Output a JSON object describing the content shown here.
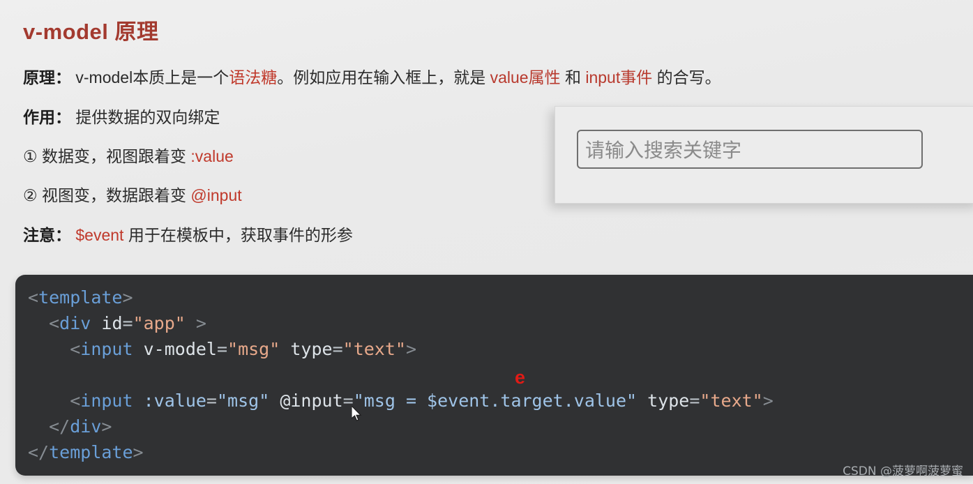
{
  "slide": {
    "title": "v-model 原理",
    "background_color": "#ececec",
    "title_color": "#a33a2f"
  },
  "body_lines": {
    "principle": {
      "label": "原理：",
      "part1": " v-model本质上是一个",
      "highlight1": "语法糖",
      "part2": "。例如应用在输入框上，就是 ",
      "highlight2": "value属性",
      "part3": " 和 ",
      "highlight3": "input事件",
      "part4": " 的合写。"
    },
    "role": {
      "label": "作用：",
      "text": " 提供数据的双向绑定"
    },
    "point1": {
      "marker": "①",
      "text": " 数据变，视图跟着变 ",
      "highlight": ":value"
    },
    "point2": {
      "marker": "②",
      "text": " 视图变，数据跟着变 ",
      "highlight": "@input"
    },
    "note": {
      "label": "注意：",
      "highlight": " $event",
      "text": " 用于在模板中，获取事件的形参"
    }
  },
  "demo_panel": {
    "input_placeholder": "请输入搜索关键字"
  },
  "code": {
    "lines": [
      {
        "id": "line-template-open",
        "tokens": [
          {
            "t": "punct",
            "v": "<"
          },
          {
            "t": "tag",
            "v": "template"
          },
          {
            "t": "punct",
            "v": ">"
          }
        ]
      },
      {
        "id": "line-div-open",
        "tokens": [
          {
            "t": "plain",
            "v": "  "
          },
          {
            "t": "punct",
            "v": "<"
          },
          {
            "t": "tag",
            "v": "div"
          },
          {
            "t": "plain",
            "v": " "
          },
          {
            "t": "attr",
            "v": "id"
          },
          {
            "t": "eq",
            "v": "="
          },
          {
            "t": "str",
            "v": "\"app\""
          },
          {
            "t": "plain",
            "v": " "
          },
          {
            "t": "punct",
            "v": ">"
          }
        ]
      },
      {
        "id": "line-input-vmodel",
        "tokens": [
          {
            "t": "plain",
            "v": "    "
          },
          {
            "t": "punct",
            "v": "<"
          },
          {
            "t": "tag",
            "v": "input"
          },
          {
            "t": "plain",
            "v": " "
          },
          {
            "t": "attr",
            "v": "v-model"
          },
          {
            "t": "eq",
            "v": "="
          },
          {
            "t": "str",
            "v": "\"msg\""
          },
          {
            "t": "plain",
            "v": " "
          },
          {
            "t": "attr",
            "v": "type"
          },
          {
            "t": "eq",
            "v": "="
          },
          {
            "t": "str",
            "v": "\"text\""
          },
          {
            "t": "punct",
            "v": ">"
          }
        ]
      },
      {
        "id": "line-blank",
        "tokens": [
          {
            "t": "plain",
            "v": " "
          }
        ]
      },
      {
        "id": "line-input-value-input",
        "tokens": [
          {
            "t": "plain",
            "v": "    "
          },
          {
            "t": "punct",
            "v": "<"
          },
          {
            "t": "tag",
            "v": "input"
          },
          {
            "t": "plain",
            "v": " "
          },
          {
            "t": "val",
            "v": ":value"
          },
          {
            "t": "eq",
            "v": "="
          },
          {
            "t": "val",
            "v": "\"msg\""
          },
          {
            "t": "plain",
            "v": " "
          },
          {
            "t": "attr",
            "v": "@input"
          },
          {
            "t": "eq",
            "v": "="
          },
          {
            "t": "val",
            "v": "\"msg = $event.target.value\""
          },
          {
            "t": "plain",
            "v": " "
          },
          {
            "t": "attr",
            "v": "type"
          },
          {
            "t": "eq",
            "v": "="
          },
          {
            "t": "str",
            "v": "\"text\""
          },
          {
            "t": "punct",
            "v": ">"
          }
        ]
      },
      {
        "id": "line-div-close",
        "tokens": [
          {
            "t": "plain",
            "v": "  "
          },
          {
            "t": "punct",
            "v": "</"
          },
          {
            "t": "tag",
            "v": "div"
          },
          {
            "t": "punct",
            "v": ">"
          }
        ]
      },
      {
        "id": "line-template-close",
        "tokens": [
          {
            "t": "punct",
            "v": "</"
          },
          {
            "t": "tag",
            "v": "template"
          },
          {
            "t": "punct",
            "v": ">"
          }
        ]
      }
    ],
    "annotation": "e",
    "annotation_color": "#e01b16",
    "background_color": "#303133"
  },
  "watermark": {
    "text": "CSDN @菠萝啊菠萝蜜"
  }
}
